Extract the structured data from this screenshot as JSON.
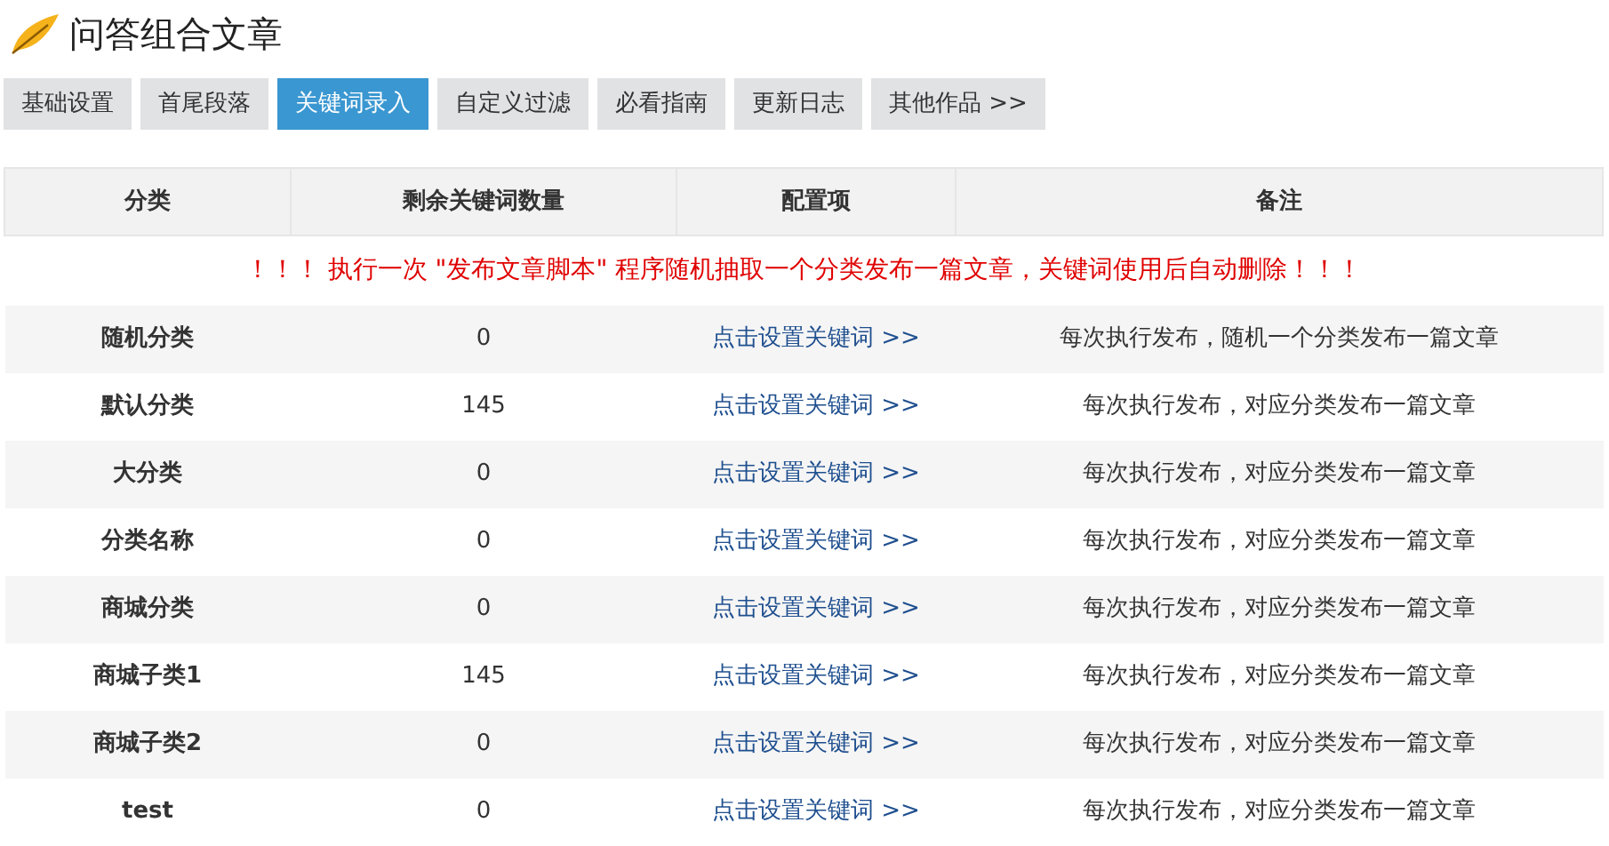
{
  "title": "问答组合文章",
  "tabs": [
    {
      "label": "基础设置",
      "selected": false
    },
    {
      "label": "首尾段落",
      "selected": false
    },
    {
      "label": "关键词录入",
      "selected": true
    },
    {
      "label": "自定义过滤",
      "selected": false
    },
    {
      "label": "必看指南",
      "selected": false
    },
    {
      "label": "更新日志",
      "selected": false
    },
    {
      "label": "其他作品 >>",
      "selected": false
    }
  ],
  "table": {
    "columns": [
      "分类",
      "剩余关键词数量",
      "配置项",
      "备注"
    ],
    "notice": "！！！ 执行一次 \"发布文章脚本\" 程序随机抽取一个分类发布一篇文章，关键词使用后自动删除！！！",
    "rows": [
      {
        "category": "随机分类",
        "count": "0",
        "action": "点击设置关键词 >>",
        "note": "每次执行发布，随机一个分类发布一篇文章"
      },
      {
        "category": "默认分类",
        "count": "145",
        "action": "点击设置关键词 >>",
        "note": "每次执行发布，对应分类发布一篇文章"
      },
      {
        "category": "大分类",
        "count": "0",
        "action": "点击设置关键词 >>",
        "note": "每次执行发布，对应分类发布一篇文章"
      },
      {
        "category": "分类名称",
        "count": "0",
        "action": "点击设置关键词 >>",
        "note": "每次执行发布，对应分类发布一篇文章"
      },
      {
        "category": "商城分类",
        "count": "0",
        "action": "点击设置关键词 >>",
        "note": "每次执行发布，对应分类发布一篇文章"
      },
      {
        "category": "商城子类1",
        "count": "145",
        "action": "点击设置关键词 >>",
        "note": "每次执行发布，对应分类发布一篇文章"
      },
      {
        "category": "商城子类2",
        "count": "0",
        "action": "点击设置关键词 >>",
        "note": "每次执行发布，对应分类发布一篇文章"
      },
      {
        "category": "test",
        "count": "0",
        "action": "点击设置关键词 >>",
        "note": "每次执行发布，对应分类发布一篇文章"
      }
    ]
  }
}
